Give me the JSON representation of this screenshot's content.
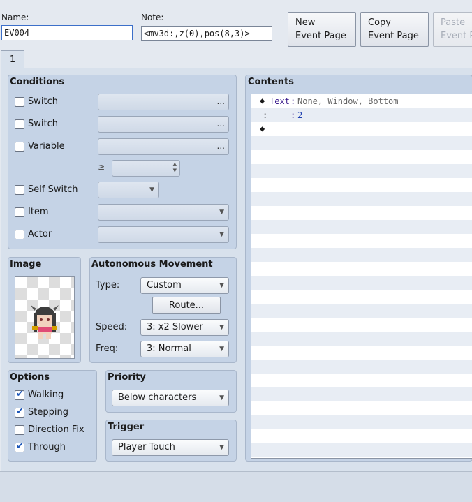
{
  "header": {
    "name_label": "Name:",
    "name_value": "EV004",
    "note_label": "Note:",
    "note_value": "<mv3d:,z(0),pos(8,3)>",
    "new_page": [
      "New",
      "Event Page"
    ],
    "copy_page": [
      "Copy",
      "Event Page"
    ],
    "paste_page": [
      "Paste",
      "Event Page"
    ]
  },
  "tabs": [
    {
      "label": "1"
    }
  ],
  "conditions": {
    "title": "Conditions",
    "items": [
      {
        "label": "Switch",
        "checked": false
      },
      {
        "label": "Switch",
        "checked": false
      },
      {
        "label": "Variable",
        "checked": false
      },
      {
        "label": "Self Switch",
        "checked": false
      },
      {
        "label": "Item",
        "checked": false
      },
      {
        "label": "Actor",
        "checked": false
      }
    ],
    "more_glyph": "...",
    "gte_glyph": "≥"
  },
  "image": {
    "title": "Image"
  },
  "movement": {
    "title": "Autonomous Movement",
    "type_label": "Type:",
    "type_value": "Custom",
    "route_button": "Route...",
    "speed_label": "Speed:",
    "speed_value": "3: x2 Slower",
    "freq_label": "Freq:",
    "freq_value": "3: Normal"
  },
  "options": {
    "title": "Options",
    "items": [
      {
        "label": "Walking",
        "checked": true
      },
      {
        "label": "Stepping",
        "checked": true
      },
      {
        "label": "Direction Fix",
        "checked": false
      },
      {
        "label": "Through",
        "checked": true
      }
    ]
  },
  "priority": {
    "title": "Priority",
    "value": "Below characters"
  },
  "trigger": {
    "title": "Trigger",
    "value": "Player Touch"
  },
  "contents": {
    "title": "Contents",
    "commands": [
      {
        "marker": "◆",
        "keyword": "Text",
        "sep": ":",
        "params": "None, Window, Bottom"
      },
      {
        "marker": ":",
        "keyword": "",
        "sep": ":",
        "params": "2"
      },
      {
        "marker": "◆",
        "keyword": "",
        "sep": "",
        "params": ""
      }
    ]
  },
  "colors": {
    "keyword": "#3a1b8c",
    "params": "#666666",
    "param_value": "#1e3fb0",
    "accent": "#1c56b8"
  }
}
